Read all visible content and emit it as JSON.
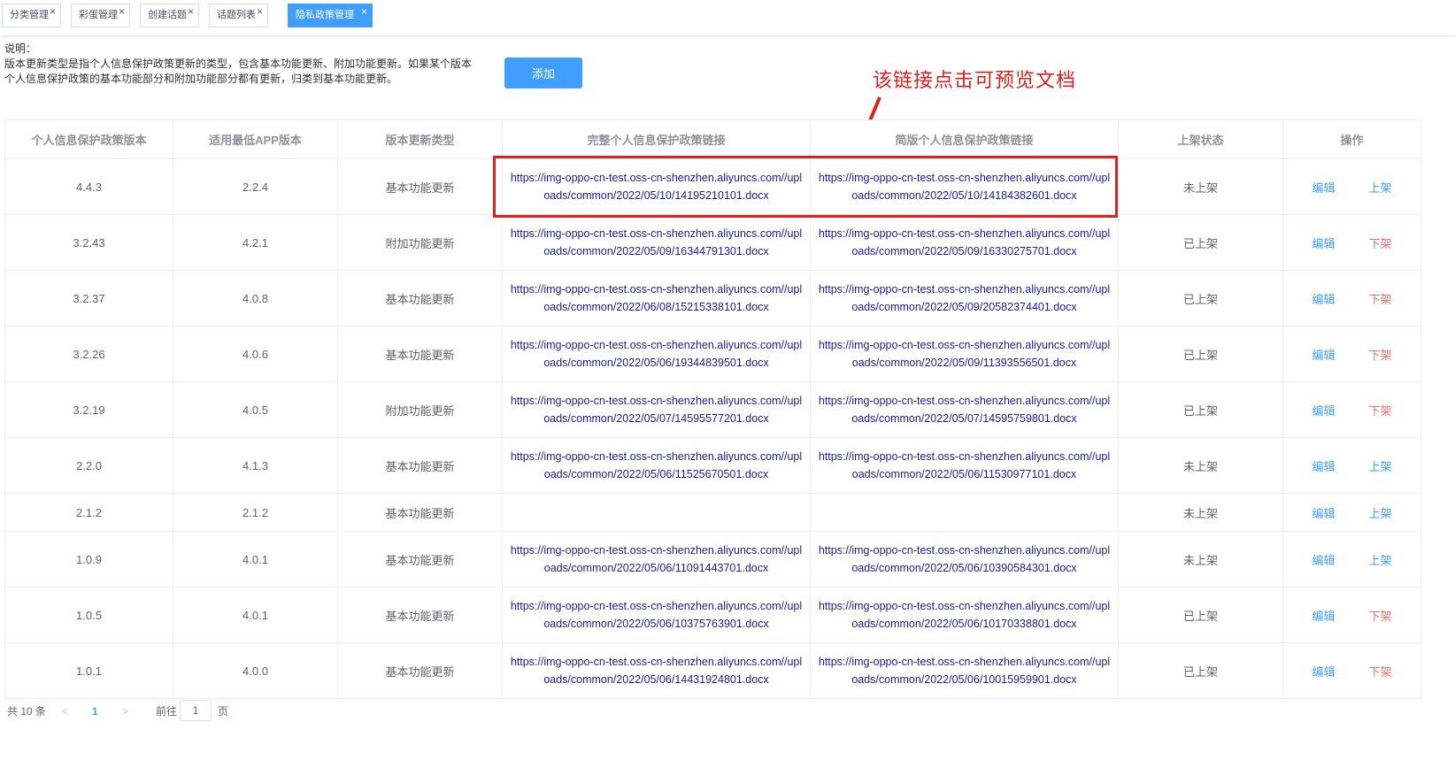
{
  "tabs": [
    {
      "label": "分类管理",
      "active": false
    },
    {
      "label": "彩蛋管理",
      "active": false
    },
    {
      "label": "创建话题",
      "active": false
    },
    {
      "label": "话题列表",
      "active": false
    },
    {
      "label": "隐私政策管理",
      "active": true
    }
  ],
  "tab_close_glyph": "×",
  "description": {
    "title": "说明：",
    "line1": "版本更新类型是指个人信息保护政策更新的类型，包含基本功能更新、附加功能更新。如果某个版本",
    "line2": "个人信息保护政策的基本功能部分和附加功能部分都有更新，归类到基本功能更新。"
  },
  "add_button": "添加",
  "annotation": "该链接点击可预览文档",
  "table": {
    "headers": [
      "个人信息保护政策版本",
      "适用最低APP版本",
      "版本更新类型",
      "完整个人信息保护政策链接",
      "简版个人信息保护政策链接",
      "上架状态",
      "操作"
    ],
    "edit_label": "编辑",
    "rows": [
      {
        "version": "4.4.3",
        "min_app": "2.2.4",
        "type": "基本功能更新",
        "full_link": "https://img-oppo-cn-test.oss-cn-shenzhen.aliyuncs.com//uploads/common/2022/05/10/14195210101.docx",
        "brief_link": "https://img-oppo-cn-test.oss-cn-shenzhen.aliyuncs.com//uploads/common/2022/05/10/14184382601.docx",
        "status": "未上架",
        "action": "上架"
      },
      {
        "version": "3.2.43",
        "min_app": "4.2.1",
        "type": "附加功能更新",
        "full_link": "https://img-oppo-cn-test.oss-cn-shenzhen.aliyuncs.com//uploads/common/2022/05/09/16344791301.docx",
        "brief_link": "https://img-oppo-cn-test.oss-cn-shenzhen.aliyuncs.com//uploads/common/2022/05/09/16330275701.docx",
        "status": "已上架",
        "action": "下架"
      },
      {
        "version": "3.2.37",
        "min_app": "4.0.8",
        "type": "基本功能更新",
        "full_link": "https://img-oppo-cn-test.oss-cn-shenzhen.aliyuncs.com//uploads/common/2022/06/08/15215338101.docx",
        "brief_link": "https://img-oppo-cn-test.oss-cn-shenzhen.aliyuncs.com//uploads/common/2022/05/09/20582374401.docx",
        "status": "已上架",
        "action": "下架"
      },
      {
        "version": "3.2.26",
        "min_app": "4.0.6",
        "type": "基本功能更新",
        "full_link": "https://img-oppo-cn-test.oss-cn-shenzhen.aliyuncs.com//uploads/common/2022/05/06/19344839501.docx",
        "brief_link": "https://img-oppo-cn-test.oss-cn-shenzhen.aliyuncs.com//uploads/common/2022/05/09/11393556501.docx",
        "status": "已上架",
        "action": "下架"
      },
      {
        "version": "3.2.19",
        "min_app": "4.0.5",
        "type": "附加功能更新",
        "full_link": "https://img-oppo-cn-test.oss-cn-shenzhen.aliyuncs.com//uploads/common/2022/05/07/14595577201.docx",
        "brief_link": "https://img-oppo-cn-test.oss-cn-shenzhen.aliyuncs.com//uploads/common/2022/05/07/14595759801.docx",
        "status": "已上架",
        "action": "下架"
      },
      {
        "version": "2.2.0",
        "min_app": "4.1.3",
        "type": "基本功能更新",
        "full_link": "https://img-oppo-cn-test.oss-cn-shenzhen.aliyuncs.com//uploads/common/2022/05/06/11525670501.docx",
        "brief_link": "https://img-oppo-cn-test.oss-cn-shenzhen.aliyuncs.com//uploads/common/2022/05/06/11530977101.docx",
        "status": "未上架",
        "action": "上架"
      },
      {
        "version": "2.1.2",
        "min_app": "2.1.2",
        "type": "基本功能更新",
        "full_link": "",
        "brief_link": "",
        "status": "未上架",
        "action": "上架"
      },
      {
        "version": "1.0.9",
        "min_app": "4.0.1",
        "type": "基本功能更新",
        "full_link": "https://img-oppo-cn-test.oss-cn-shenzhen.aliyuncs.com//uploads/common/2022/05/06/11091443701.docx",
        "brief_link": "https://img-oppo-cn-test.oss-cn-shenzhen.aliyuncs.com//uploads/common/2022/05/06/10390584301.docx",
        "status": "未上架",
        "action": "上架"
      },
      {
        "version": "1.0.5",
        "min_app": "4.0.1",
        "type": "基本功能更新",
        "full_link": "https://img-oppo-cn-test.oss-cn-shenzhen.aliyuncs.com//uploads/common/2022/05/06/10375763901.docx",
        "brief_link": "https://img-oppo-cn-test.oss-cn-shenzhen.aliyuncs.com//uploads/common/2022/05/06/10170338801.docx",
        "status": "已上架",
        "action": "下架"
      },
      {
        "version": "1.0.1",
        "min_app": "4.0.0",
        "type": "基本功能更新",
        "full_link": "https://img-oppo-cn-test.oss-cn-shenzhen.aliyuncs.com//uploads/common/2022/05/06/14431924801.docx",
        "brief_link": "https://img-oppo-cn-test.oss-cn-shenzhen.aliyuncs.com//uploads/common/2022/05/06/10015959901.docx",
        "status": "已上架",
        "action": "下架"
      }
    ]
  },
  "pagination": {
    "total_text": "共 10 条",
    "prev_glyph": "<",
    "current_page": "1",
    "next_glyph": ">",
    "goto_label": "前往",
    "goto_value": "1",
    "page_suffix": "页"
  },
  "colors": {
    "primary": "#409eff",
    "danger": "#f56c6c",
    "annotation_red": "#e02020",
    "link": "#1a1aa6"
  }
}
